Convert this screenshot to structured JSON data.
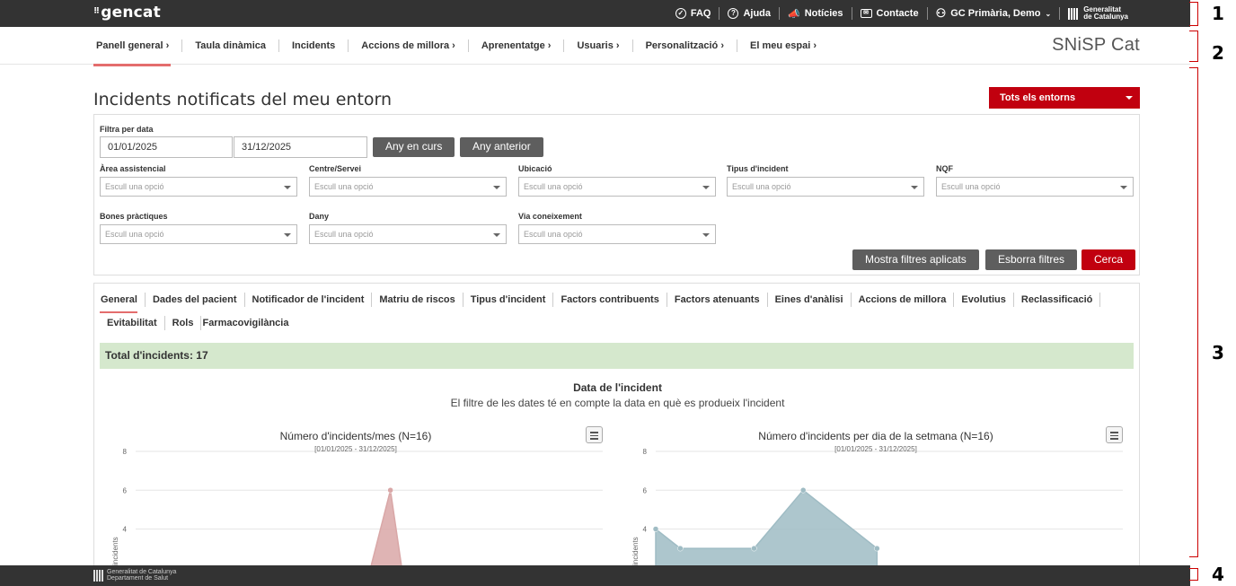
{
  "topbar": {
    "logo": "gencat",
    "links": [
      {
        "icon": "check-circle-icon",
        "label": "FAQ"
      },
      {
        "icon": "question-circle-icon",
        "label": "Ajuda"
      },
      {
        "icon": "megaphone-icon",
        "label": "Notícies"
      },
      {
        "icon": "mail-icon",
        "label": "Contacte"
      },
      {
        "icon": "user-icon",
        "label": "GC Primària, Demo"
      }
    ],
    "brand_line1": "Generalitat",
    "brand_line2": "de Catalunya"
  },
  "markers": [
    "1",
    "2",
    "3",
    "4"
  ],
  "mainnav": {
    "items": [
      "Panell general",
      "Taula dinàmica",
      "Incidents",
      "Accions de millora",
      "Aprenentatge",
      "Usuaris",
      "Personalització",
      "El meu espai"
    ],
    "brand": "SNiSP Cat"
  },
  "page": {
    "title": "Incidents notificats del meu entorn",
    "env_select": "Tots els entorns"
  },
  "filters": {
    "date_label": "Filtra per data",
    "date_from": "01/01/2025",
    "date_to": "31/12/2025",
    "btn_current_year": "Any en curs",
    "btn_previous_year": "Any anterior",
    "placeholder": "Escull una opció",
    "fields": [
      "Àrea assistencial",
      "Centre/Servei",
      "Ubicació",
      "Tipus d'incident",
      "NQF",
      "Bones pràctiques",
      "Dany",
      "Via coneixement"
    ],
    "btn_show": "Mostra filtres aplicats",
    "btn_clear": "Esborra filtres",
    "btn_search": "Cerca"
  },
  "tabs": [
    "General",
    "Dades del pacient",
    "Notificador de l'incident",
    "Matriu de riscos",
    "Tipus d'incident",
    "Factors contribuents",
    "Factors atenuants",
    "Eines d'anàlisi",
    "Accions de millora",
    "Evolutius",
    "Reclassificació",
    "Evitabilitat",
    "Rols",
    "Farmacovigilància"
  ],
  "total": "Total d'incidents: 17",
  "section": {
    "title": "Data de l'incident",
    "subtitle": "El filtre de les dates té en compte la data en què es produeix l'incident"
  },
  "chart_data": [
    {
      "type": "area",
      "title": "Número d'incidents/mes (N=16)",
      "subtitle": "[01/01/2025 - 31/12/2025]",
      "ylabel": "ero d'incidents",
      "yticks": [
        "8",
        "6",
        "4"
      ],
      "ylim": [
        0,
        8
      ],
      "color": "#d9a7a7",
      "points": [
        {
          "x": 5.3,
          "y": 0
        },
        {
          "x": 6,
          "y": 6
        },
        {
          "x": 6.4,
          "y": 0
        }
      ],
      "xlim": [
        0,
        11
      ]
    },
    {
      "type": "area",
      "title": "Número d'incidents per dia de la setmana (N=16)",
      "subtitle": "[01/01/2025 - 31/12/2025]",
      "ylabel": "ero d'incidents",
      "yticks": [
        "8",
        "6",
        "4"
      ],
      "ylim": [
        0,
        8
      ],
      "color": "#9fbcc4",
      "points": [
        {
          "x": 0,
          "y": 4
        },
        {
          "x": 0.5,
          "y": 3
        },
        {
          "x": 2,
          "y": 3
        },
        {
          "x": 3,
          "y": 6
        },
        {
          "x": 4.5,
          "y": 3
        }
      ],
      "xlim": [
        0,
        9.5
      ]
    }
  ],
  "footer": {
    "line1": "Generalitat de Catalunya",
    "line2": "Departament de Salut"
  }
}
